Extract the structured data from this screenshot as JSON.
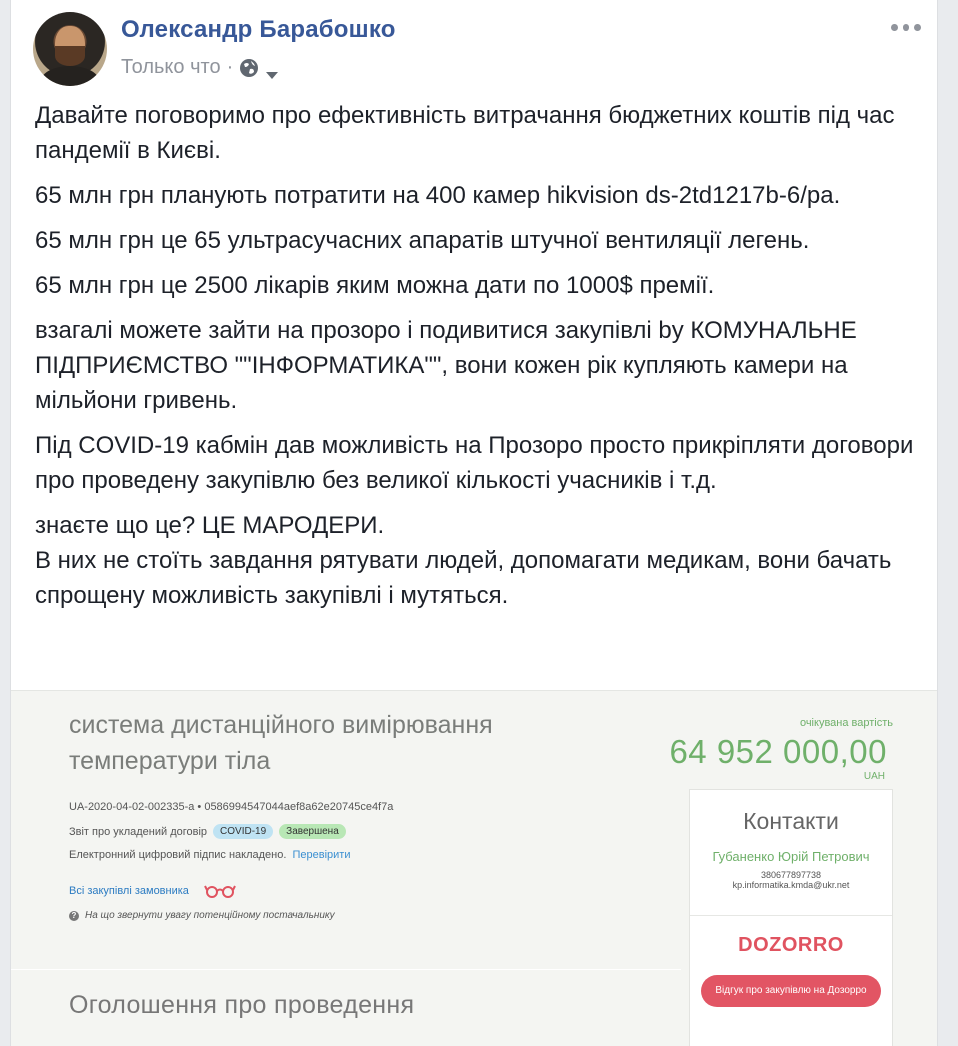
{
  "post": {
    "author": "Олександр Барабошко",
    "timestamp": "Только что",
    "separator": "·",
    "audience_icon": "globe-icon",
    "more_icon": "more-options-icon",
    "paragraphs": [
      "Давайте поговоримо про ефективність витрачання бюджетних коштів під час пандемії в Києві.",
      "65 млн грн планують потратити на 400 камер hikvision ds-2td1217b-6/pa.",
      "65 млн грн це 65 ультрасучасних апаратів штучної вентиляції легень.",
      "65 млн грн це 2500 лікарів яким можна дати по 1000$ премії.",
      "взагалі можете зайти на прозоро і подивитися закупівлі by КОМУНАЛЬНЕ ПІДПРИЄМСТВО \"\"ІНФОРМАТИКА\"\", вони кожен рік купляють камери на мільйони гривень.",
      "Під COVID-19 кабмін дав можливість на Прозоро просто прикріпляти договори про проведену закупівлю без великої кількості учасників і т.д.",
      "знаєте що це? ЦЕ МАРОДЕРИ.\nВ них не стоїть завдання рятувати людей, допомагати медикам, вони бачать спрощену можливість закупівлі і мутяться."
    ]
  },
  "card": {
    "title": "система дистанційного вимірювання температури тіла",
    "price_label": "очікувана вартість",
    "price": "64 952 000,00",
    "currency": "UAH",
    "tender_id": "UA-2020-04-02-002335-a • 0586994547044aef8a62e20745ce4f7a",
    "report_label": "Звіт про укладений договір",
    "tag_covid": "COVID-19",
    "tag_status": "Завершена",
    "sign_text": "Електронний цифровий підпис накладено.",
    "sign_link": "Перевірити",
    "all_tenders": "Всі закупівлі замовника",
    "note": "На що звернути увагу потенційному постачальнику",
    "announce": "Оголошення про проведення",
    "contacts": {
      "title": "Контакти",
      "name": "Губаненко Юрій Петрович",
      "phone": "380677897738",
      "email": "kp.informatika.kmda@ukr.net"
    },
    "dozorro_logo": "DOZORRO",
    "dozorro_button": "Відгук про закупівлю на Дозорро"
  },
  "colors": {
    "author": "#385898",
    "price": "#6fb06a",
    "dozorro": "#e25564"
  }
}
